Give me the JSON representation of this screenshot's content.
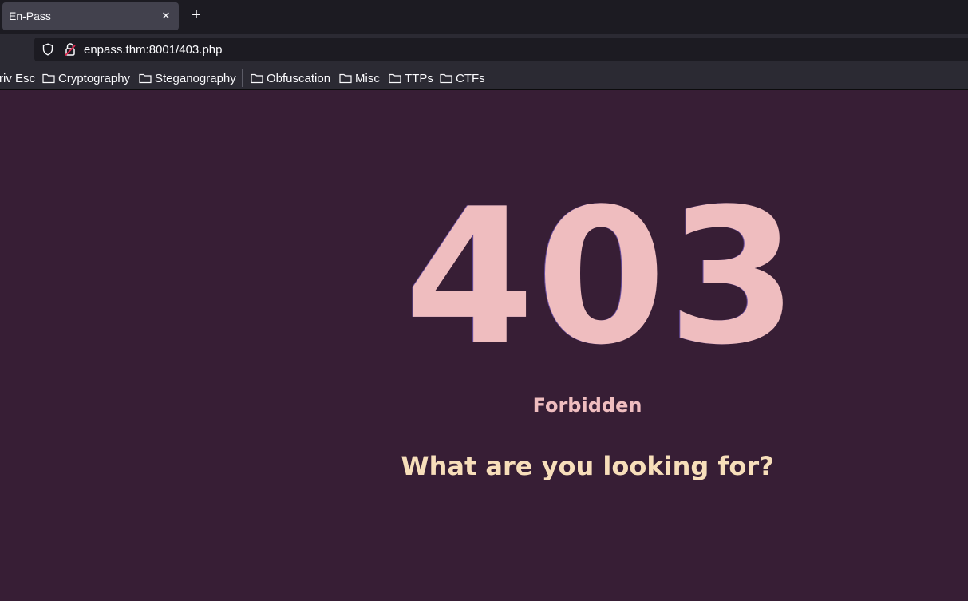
{
  "tab": {
    "title": "En-Pass",
    "close_icon": "close-icon",
    "new_tab_icon": "plus-icon"
  },
  "navbar": {
    "url": "enpass.thm:8001/403.php",
    "shield_icon": "tracking-protection-shield-icon",
    "lock_icon": "insecure-lock-icon"
  },
  "bookmarks": {
    "items": [
      {
        "label": "riv Esc"
      },
      {
        "label": "Cryptography"
      },
      {
        "label": "Steganography"
      },
      {
        "label": "Obfuscation"
      },
      {
        "label": "Misc"
      },
      {
        "label": "TTPs"
      },
      {
        "label": "CTFs"
      }
    ]
  },
  "page": {
    "code": "403",
    "status": "Forbidden",
    "question": "What are you looking for?"
  },
  "colors": {
    "page_background": "#371e35",
    "code_color": "#efbdbf",
    "question_color": "#f7deba",
    "chrome_dark": "#1c1b22",
    "chrome_mid": "#2b2a33"
  }
}
